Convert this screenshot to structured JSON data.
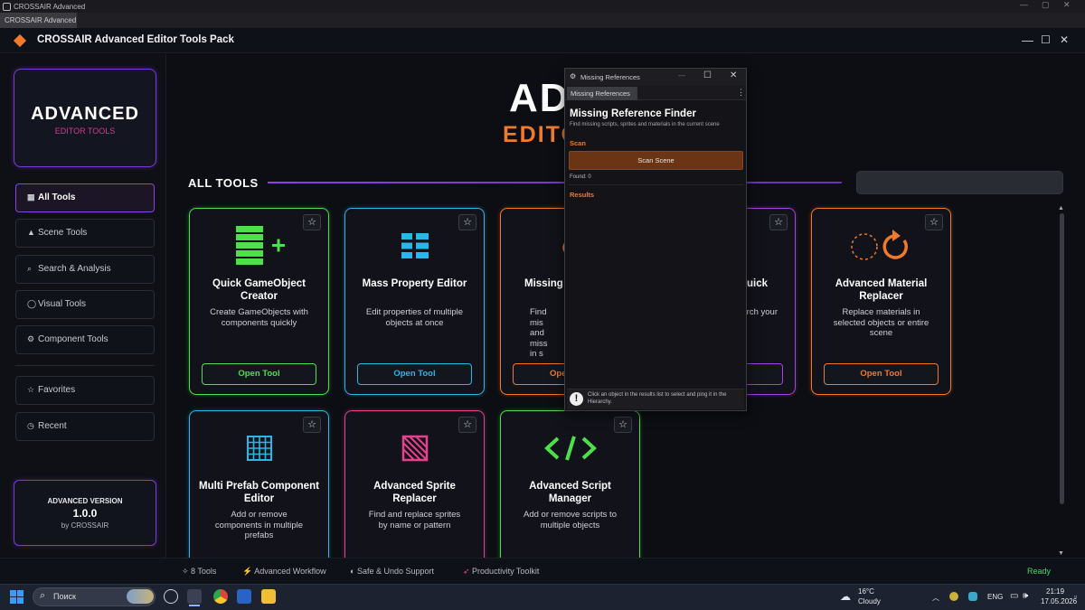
{
  "os": {
    "window_title": "CROSSAIR Advanced",
    "tab_label": "CROSSAIR Advanced"
  },
  "header": {
    "title": "CROSSAIR Advanced Editor Tools Pack",
    "accent": "#f07a2a"
  },
  "sidebar": {
    "brand_title": "ADVANCED",
    "brand_subtitle": "EDITOR TOOLS",
    "items": [
      {
        "label": "All Tools",
        "icon": "grid-icon",
        "glyph": "▦"
      },
      {
        "label": "Scene Tools",
        "icon": "triangle-icon",
        "glyph": "▲"
      },
      {
        "label": "Search & Analysis",
        "icon": "search-icon",
        "glyph": "⌕"
      },
      {
        "label": "Visual Tools",
        "icon": "circle-icon",
        "glyph": "◯"
      },
      {
        "label": "Component Tools",
        "icon": "gear-icon",
        "glyph": "⚙"
      },
      {
        "label": "Favorites",
        "icon": "star-icon",
        "glyph": "☆"
      },
      {
        "label": "Recent",
        "icon": "clock-icon",
        "glyph": "◷"
      }
    ],
    "version_label": "ADVANCED VERSION",
    "version_number": "1.0.0",
    "version_author": "by CROSSAIR"
  },
  "main": {
    "hero_title": "AD",
    "hero_subtitle": "EDITO",
    "section_heading": "ALL TOOLS",
    "search_value": "",
    "cards": [
      {
        "title": "Quick GameObject Creator",
        "desc": "Create GameObjects with components quickly",
        "button": "Open Tool",
        "color": "#4ee04a",
        "icon": "stack-add-icon"
      },
      {
        "title": "Mass Property Editor",
        "desc": "Edit properties of multiple objects at once",
        "button": "Open Tool",
        "color": "#29b6e8",
        "icon": "grid-list-icon"
      },
      {
        "title": "Missing Fi",
        "desc": "Find mis and miss in s",
        "button": "Ope",
        "color": "#f07a2a",
        "icon": "missing-icon"
      },
      {
        "title": "uick",
        "desc": "rch your",
        "button": "",
        "color": "#a83fe0",
        "icon": "search-icon"
      },
      {
        "title": "Advanced Material Replacer",
        "desc": "Replace materials in selected objects or entire scene",
        "button": "Open Tool",
        "color": "#f07a2a",
        "icon": "refresh-icon"
      },
      {
        "title": "Multi Prefab Component Editor",
        "desc": "Add or remove components in multiple prefabs",
        "button": "Open Tool",
        "color": "#29b6e8",
        "icon": "grid-icon"
      },
      {
        "title": "Advanced Sprite Replacer",
        "desc": "Find and replace sprites by name or pattern",
        "button": "Open Tool",
        "color": "#e8408f",
        "icon": "hatch-icon"
      },
      {
        "title": "Advanced Script Manager",
        "desc": "Add or remove scripts to multiple objects",
        "button": "Open Tool",
        "color": "#4ee04a",
        "icon": "code-icon"
      }
    ]
  },
  "statusbar": {
    "items": [
      "8 Tools",
      "Advanced Workflow",
      "Safe & Undo Support",
      "Productivity Toolkit"
    ],
    "ready": "Ready"
  },
  "float_window": {
    "window_title": "Missing References",
    "tab_label": "Missing References",
    "title": "Missing Reference Finder",
    "desc": "Find missing scripts, sprites and materials in the current scene",
    "scan_label": "Scan",
    "scan_button": "Scan Scene",
    "found": "Found: 0",
    "results_label": "Results",
    "footer_text": "Click an object in the results list to select and ping it in the Hierarchy."
  },
  "taskbar": {
    "search_placeholder": "Поиск",
    "weather_temp": "16°C",
    "weather_desc": "Cloudy",
    "lang": "ENG",
    "time": "21:19",
    "date": "17.05.2026"
  }
}
